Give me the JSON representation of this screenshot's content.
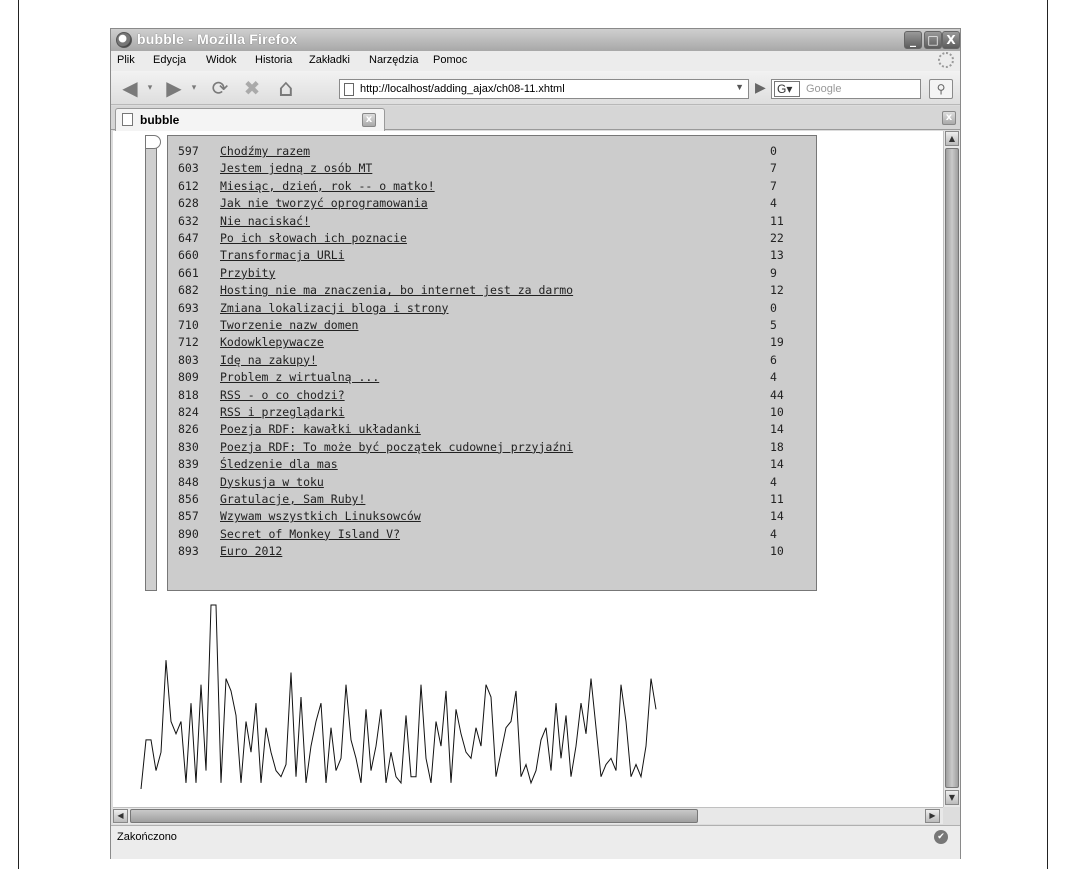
{
  "window": {
    "title": "bubble - Mozilla Firefox",
    "minimize_label": "_",
    "maximize_label": "□",
    "close_label": "X"
  },
  "menu": [
    {
      "label": "Plik"
    },
    {
      "label": "Edycja"
    },
    {
      "label": "Widok"
    },
    {
      "label": "Historia"
    },
    {
      "label": "Zakładki"
    },
    {
      "label": "Narzędzia"
    },
    {
      "label": "Pomoc"
    }
  ],
  "nav": {
    "back_icon": "◀",
    "forward_icon": "▶",
    "reload_icon": "⟳",
    "stop_icon": "✖",
    "home_icon": "⌂",
    "url": "http://localhost/adding_ajax/ch08-11.xhtml",
    "url_dropdown": "▼",
    "go_icon": "▶",
    "search_engine": "G▾",
    "search_placeholder": "Google",
    "search_button": "⚲"
  },
  "tabs": [
    {
      "label": "bubble",
      "close": "x"
    }
  ],
  "tabbar_close": "x",
  "status": {
    "text": "Zakończono",
    "icon": "✔"
  },
  "list_rows": [
    {
      "id": "597",
      "title": "Chodźmy razem",
      "count": "0"
    },
    {
      "id": "603",
      "title": "Jestem jedną z osób MT",
      "count": "7"
    },
    {
      "id": "612",
      "title": "Miesiąc, dzień, rok -- o matko!",
      "count": "7"
    },
    {
      "id": "628",
      "title": "Jak nie tworzyć oprogramowania",
      "count": "4"
    },
    {
      "id": "632",
      "title": "Nie naciskać!",
      "count": "11"
    },
    {
      "id": "647",
      "title": "Po ich słowach ich poznacie",
      "count": "22"
    },
    {
      "id": "660",
      "title": "Transformacja URLi",
      "count": "13"
    },
    {
      "id": "661",
      "title": "Przybity",
      "count": "9"
    },
    {
      "id": "682",
      "title": "Hosting nie ma znaczenia, bo internet jest za darmo",
      "count": "12"
    },
    {
      "id": "693",
      "title": "Zmiana lokalizacji bloga i strony",
      "count": "0"
    },
    {
      "id": "710",
      "title": "Tworzenie nazw domen",
      "count": "5"
    },
    {
      "id": "712",
      "title": "Kodowklepywacze",
      "count": "19"
    },
    {
      "id": "803",
      "title": "Idę na zakupy!",
      "count": "6"
    },
    {
      "id": "809",
      "title": "Problem z wirtualną ...",
      "count": "4"
    },
    {
      "id": "818",
      "title": "RSS - o co chodzi?",
      "count": "44"
    },
    {
      "id": "824",
      "title": "RSS i przeglądarki",
      "count": "10"
    },
    {
      "id": "826",
      "title": "Poezja RDF: kawałki układanki",
      "count": "14"
    },
    {
      "id": "830",
      "title": "Poezja RDF: To może być początek cudownej przyjaźni",
      "count": "18"
    },
    {
      "id": "839",
      "title": "Śledzenie dla mas",
      "count": "14"
    },
    {
      "id": "848",
      "title": "Dyskusja w toku",
      "count": "4"
    },
    {
      "id": "856",
      "title": "Gratulacje, Sam Ruby!",
      "count": "11"
    },
    {
      "id": "857",
      "title": "Wzywam wszystkich Linuksowców",
      "count": "14"
    },
    {
      "id": "890",
      "title": "Secret of Monkey Island V?",
      "count": "4"
    },
    {
      "id": "893",
      "title": "Euro 2012",
      "count": "10"
    }
  ],
  "chart_data": {
    "type": "line",
    "values": [
      0,
      8,
      8,
      3,
      6,
      21,
      11,
      9,
      11,
      1,
      14,
      1,
      17,
      3,
      30,
      30,
      1,
      18,
      16,
      12,
      1,
      11,
      6,
      14,
      1,
      10,
      6,
      3,
      2,
      4,
      19,
      2,
      15,
      1,
      7,
      11,
      14,
      1,
      10,
      3,
      5,
      17,
      8,
      5,
      1,
      13,
      3,
      7,
      13,
      1,
      6,
      2,
      1,
      12,
      2,
      2,
      17,
      5,
      1,
      11,
      7,
      16,
      1,
      13,
      9,
      6,
      5,
      10,
      7,
      17,
      15,
      2,
      6,
      10,
      11,
      16,
      2,
      4,
      1,
      3,
      8,
      10,
      3,
      14,
      5,
      12,
      2,
      7,
      14,
      9,
      18,
      10,
      2,
      4,
      5,
      3,
      17,
      11,
      2,
      4,
      2,
      7,
      18,
      13
    ],
    "ylim": [
      0,
      30
    ],
    "stroke": "#111111"
  }
}
